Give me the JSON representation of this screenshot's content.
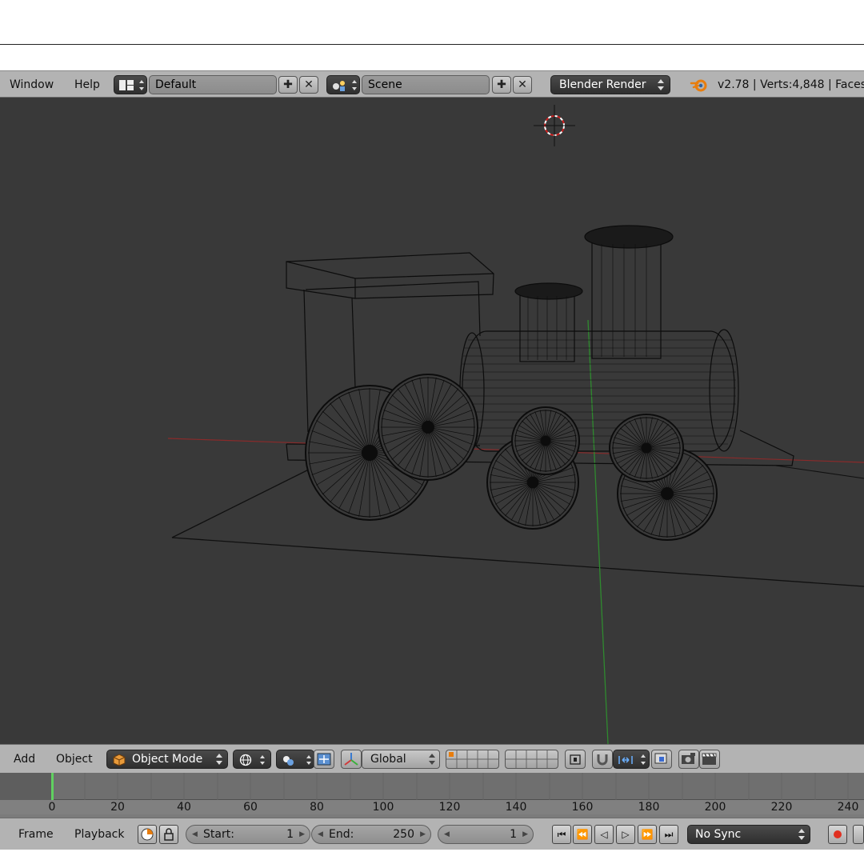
{
  "info_header": {
    "menu": [
      "Window",
      "Help"
    ],
    "screen_layout": "Default",
    "scene": "Scene",
    "render_engine": "Blender Render",
    "stats": "v2.78 | Verts:4,848 | Faces"
  },
  "view3d_header": {
    "menu": [
      "Add",
      "Object"
    ],
    "mode": "Object Mode",
    "transform_orientation": "Global"
  },
  "timeline": {
    "ruler_ticks": [
      "0",
      "20",
      "40",
      "60",
      "80",
      "100",
      "120",
      "140",
      "160",
      "180",
      "200",
      "220",
      "240"
    ],
    "current_frame_marker": 0
  },
  "timeline_header": {
    "menu": [
      "Frame",
      "Playback"
    ],
    "start_label": "Start:",
    "start_value": "1",
    "end_label": "End:",
    "end_value": "250",
    "current_frame": "1",
    "sync_mode": "No Sync"
  },
  "colors": {
    "viewport_bg": "#393939",
    "header_bg": "#b3b3b3",
    "x_axis": "#a03030",
    "y_axis": "#3a9a3a",
    "frame_marker": "#60d060"
  }
}
